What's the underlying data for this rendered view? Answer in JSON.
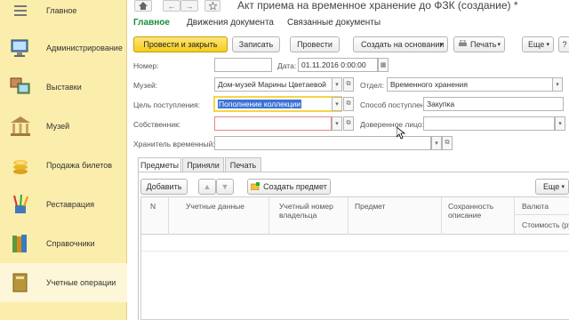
{
  "sidebar": {
    "items": [
      {
        "label": "Главное",
        "icon": "list-icon"
      },
      {
        "label": "Администрирование",
        "icon": "computer-icon"
      },
      {
        "label": "Выставки",
        "icon": "pictures-icon"
      },
      {
        "label": "Музей",
        "icon": "museum-icon"
      },
      {
        "label": "Продажа билетов",
        "icon": "coins-icon"
      },
      {
        "label": "Реставрация",
        "icon": "brushes-icon"
      },
      {
        "label": "Справочники",
        "icon": "books-icon"
      },
      {
        "label": "Учетные операции",
        "icon": "ledger-icon"
      }
    ]
  },
  "header": {
    "title": "Акт приема на временное хранение до ФЗК (создание) *",
    "back_symbol": "←",
    "forward_symbol": "→"
  },
  "tabs_top": [
    "Главное",
    "Движения документа",
    "Связанные документы"
  ],
  "toolbar": {
    "post_close": "Провести и закрыть",
    "save": "Записать",
    "post": "Провести",
    "create_based": "Создать на основании",
    "print": "Печать",
    "more": "Еще"
  },
  "form": {
    "number_label": "Номер:",
    "number_value": "",
    "date_label": "Дата:",
    "date_value": "01.11.2016  0:00:00",
    "museum_label": "Музей:",
    "museum_value": "Дом-музей Марины Цветаевой",
    "department_label": "Отдел:",
    "department_value": "Временного хранения",
    "purpose_label": "Цель поступления:",
    "purpose_value": "Пополнение коллекции",
    "method_label": "Способ поступления:",
    "method_value": "Закупка",
    "owner_label": "Собственник:",
    "owner_value": "",
    "trustee_label": "Доверенное лицо:",
    "trustee_value": "",
    "keeper_label": "Хранитель временный:",
    "keeper_value": ""
  },
  "inner_tabs": [
    "Предметы",
    "Приняли",
    "Печать"
  ],
  "items_toolbar": {
    "add": "Добавить",
    "create_item": "Создать предмет",
    "more": "Еще"
  },
  "table": {
    "columns": {
      "n": "N",
      "account": "Учетные данные",
      "owner_num_1": "Учетный номер",
      "owner_num_2": "владельца",
      "item": "Предмет",
      "state_1": "Сохранность",
      "state_2": "описание",
      "currency": "Валюта",
      "cost": "Стоимость (руб"
    }
  }
}
